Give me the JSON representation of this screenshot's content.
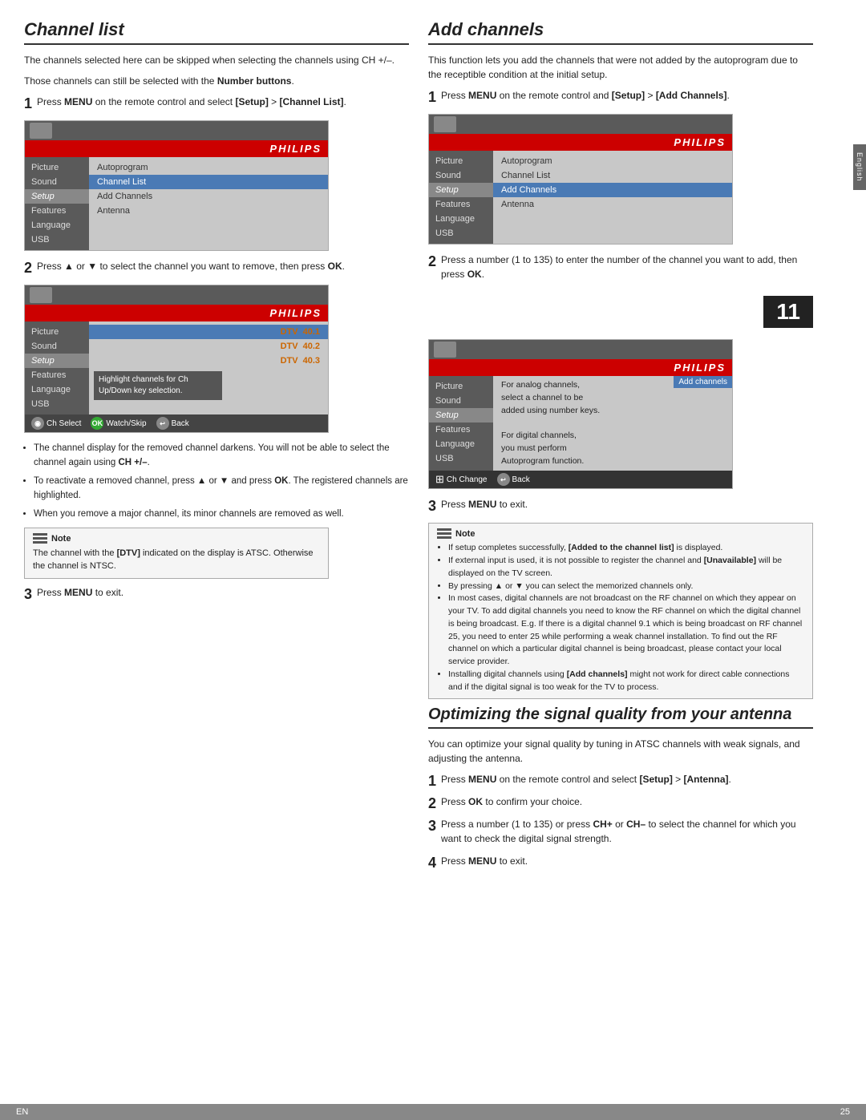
{
  "left": {
    "section_title": "Channel list",
    "intro1": "The channels selected here can be skipped when selecting the channels using CH +/–.",
    "intro2": "Those channels can still be selected with the Number buttons.",
    "step1_label": "1",
    "step1_text": "Press MENU on the remote control and select [Setup] > [Channel List].",
    "menu1": {
      "philips_brand": "PHILIPS",
      "left_items": [
        "Picture",
        "Sound",
        "Setup",
        "Features",
        "Language",
        "USB"
      ],
      "right_items": [
        "Autoprogram",
        "Channel List",
        "Add Channels",
        "Antenna"
      ],
      "highlighted_left": "Setup",
      "highlighted_right": "Channel List"
    },
    "step2_label": "2",
    "step2_text": "Press ▲ or ▼ to select the channel you want to remove, then press OK.",
    "menu2": {
      "philips_brand": "PHILIPS",
      "left_items": [
        "Picture",
        "Sound",
        "Setup",
        "Features",
        "Language",
        "USB"
      ],
      "highlighted_left": "Setup",
      "channels": [
        {
          "type": "DTV",
          "num": "40.1",
          "highlighted": true
        },
        {
          "type": "DTV",
          "num": "40.2"
        },
        {
          "type": "DTV",
          "num": "40.3"
        }
      ],
      "highlight_text": "Highlight channels for Ch Up/Down key selection.",
      "bottom": [
        {
          "icon": "circle",
          "color": "gray",
          "label": "Ch Select"
        },
        {
          "icon": "ok",
          "color": "green",
          "label": "Watch/Skip"
        },
        {
          "icon": "back",
          "color": "gray",
          "label": "Back"
        }
      ]
    },
    "bullets": [
      "The channel display for the removed channel darkens. You will not be able to select the channel again using CH +/–.",
      "To reactivate a removed channel, press ▲ or ▼ and press OK. The registered channels are highlighted.",
      "When you remove a major channel, its minor channels are removed as well."
    ],
    "note_label": "Note",
    "note_text": "The channel with the [DTV] indicated on the display is ATSC. Otherwise the channel is NTSC.",
    "step3_label": "3",
    "step3_text": "Press MENU to exit."
  },
  "right": {
    "section_title": "Add channels",
    "intro": "This function lets you add the channels that were not added by the autoprogram due to the receptible condition at the initial setup.",
    "step1_label": "1",
    "step1_text": "Press MENU on the remote control and [Setup] > [Add Channels].",
    "menu1": {
      "philips_brand": "PHILIPS",
      "left_items": [
        "Picture",
        "Sound",
        "Setup",
        "Features",
        "Language",
        "USB"
      ],
      "right_items": [
        "Autoprogram",
        "Channel List",
        "Add Channels",
        "Antenna"
      ],
      "highlighted_left": "Setup",
      "highlighted_right": "Add Channels"
    },
    "step2_label": "2",
    "step2_text": "Press a number (1 to 135) to enter the number of the channel you want to add, then press OK.",
    "number_badge": "11",
    "menu2": {
      "philips_brand": "PHILIPS",
      "left_items": [
        "Picture",
        "Sound",
        "Setup",
        "Features",
        "Language",
        "USB"
      ],
      "highlighted_left": "Setup",
      "add_channels_label": "Add channels",
      "info_lines": [
        "For analog channels,",
        "select a channel to be",
        "added using number keys.",
        "",
        "For digital channels,",
        "you must perform",
        "Autoprogram function."
      ],
      "bottom": [
        {
          "icon": "grid",
          "label": "Ch Change"
        },
        {
          "icon": "back",
          "label": "Back"
        }
      ]
    },
    "step3_label": "3",
    "step3_text": "Press MENU to exit.",
    "note_label": "Note",
    "note_bullets": [
      "If setup completes successfully, [Added to the channel list] is displayed.",
      "If external input is used, it is not possible to register the channel and [Unavailable] will be displayed on the TV screen.",
      "By pressing ▲ or ▼ you can select the memorized channels only.",
      "In most cases, digital channels are not broadcast on the RF channel on which they appear on your TV. To add digital channels you need to know the RF channel on which the digital channel is being broadcast. E.g. If there is a digital channel 9.1 which is being broadcast on RF channel 25, you need to enter 25 while performing a weak channel installation. To find out the RF channel on which a particular digital channel is being broadcast, please contact your local service provider.",
      "Installing digital channels using [Add channels] might not work for direct cable connections and if the digital signal is too weak for the TV to process."
    ],
    "opt_section": {
      "title": "Optimizing the signal quality from your antenna",
      "intro": "You can optimize your signal quality by tuning in ATSC channels with weak signals, and adjusting the antenna.",
      "steps": [
        {
          "num": "1",
          "text": "Press MENU on the remote control and select [Setup] > [Antenna]."
        },
        {
          "num": "2",
          "text": "Press OK to confirm your choice."
        },
        {
          "num": "3",
          "text": "Press a number (1 to 135) or press CH+ or CH– to select the channel for which you want to check the digital signal strength."
        },
        {
          "num": "4",
          "text": "Press MENU to exit."
        }
      ]
    }
  },
  "footer": {
    "left": "EN",
    "right": "25"
  },
  "side_tab": "English"
}
